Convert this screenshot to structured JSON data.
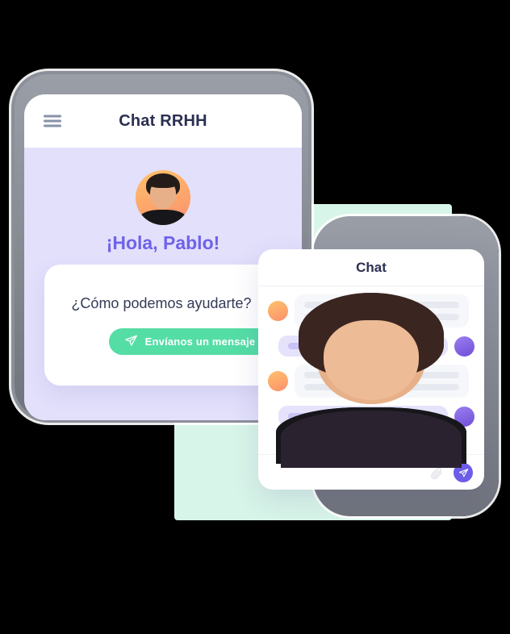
{
  "phone": {
    "menu_icon": "hamburger-menu-icon",
    "title": "Chat RRHH",
    "avatar_alt": "user-avatar",
    "greeting": "¡Hola, Pablo!",
    "question": "¿Cómo podemos ayudarte?",
    "send_button": {
      "label": "Envíanos un mensaje",
      "icon": "paper-plane-icon",
      "color": "#55dda6"
    }
  },
  "chat": {
    "title": "Chat",
    "messages": [
      {
        "side": "in",
        "avatar": "agent-avatar",
        "lines": 2
      },
      {
        "side": "out",
        "avatar": "contact-avatar",
        "lines": 1
      },
      {
        "side": "in",
        "avatar": "agent-avatar",
        "lines": 2
      },
      {
        "side": "out",
        "avatar": "contact-avatar",
        "lines": 1
      }
    ],
    "footer": {
      "attach_icon": "paperclip-icon",
      "send_icon": "send-paper-plane-icon",
      "send_color": "#6c5ce7"
    }
  },
  "theme": {
    "accent_purple": "#6f62e8",
    "accent_green": "#55dda6",
    "screen_bg": "#e2e0fb",
    "mint_block": "#d8f5e9",
    "frame_gray": "#8b8f99",
    "title_navy": "#2b2f52"
  }
}
